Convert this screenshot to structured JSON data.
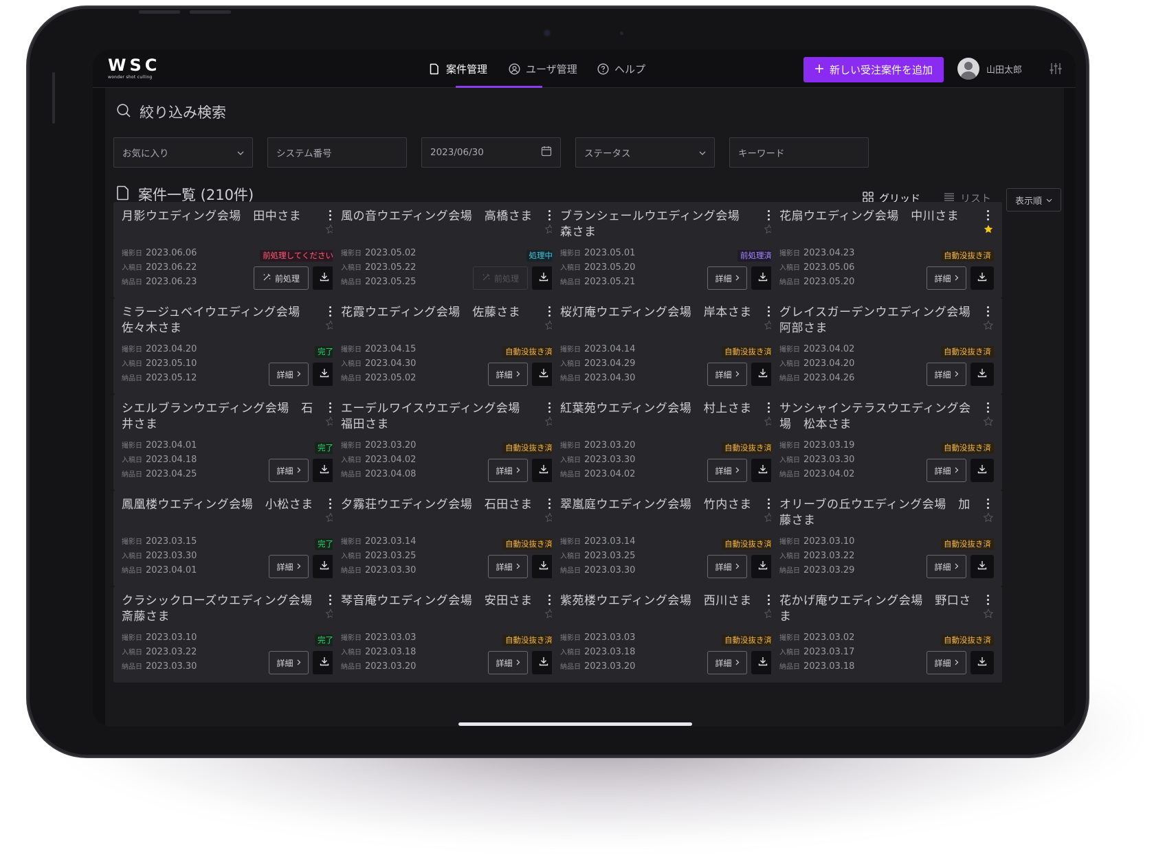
{
  "app": {
    "logo": "WSC",
    "logo_sub": "wonder shot culling"
  },
  "nav": {
    "items": [
      {
        "label": "案件管理",
        "icon": "document-icon",
        "active": true
      },
      {
        "label": "ユーザ管理",
        "icon": "user-icon",
        "active": false
      },
      {
        "label": "ヘルプ",
        "icon": "help-icon",
        "active": false
      }
    ],
    "add_button": "新しい受注案件を追加",
    "user_name": "山田太郎"
  },
  "search": {
    "title": "絞り込み検索",
    "favorites": "お気に入り",
    "system_number": "システム番号",
    "date": "2023/06/30",
    "status": "ステータス",
    "keyword": "キーワード"
  },
  "list": {
    "title": "案件一覧 (210件)",
    "grid_label": "グリッド",
    "list_label": "リスト",
    "sort_label": "表示順"
  },
  "labels": {
    "shoot": "撮影日",
    "entry": "入稿日",
    "delivery": "納品日",
    "detail": "詳細",
    "preprocess": "前処理"
  },
  "colors": {
    "accent": "#8a2bf2",
    "warn": "#ff5a7a",
    "processing": "#3fc7e0",
    "preprocessed": "#a58cff",
    "done": "#2ed47a",
    "auto": "#f2b84b",
    "favorite_star": "#f5c518"
  },
  "cards": [
    {
      "title": "月影ウエディング会場　田中さま",
      "shoot": "2023.06.06",
      "entry": "2023.06.22",
      "delivery": "2023.06.23",
      "status": "前処理してください",
      "status_type": "warn",
      "action": "preprocess",
      "favorite": false
    },
    {
      "title": "風の音ウエディング会場　高橋さま",
      "shoot": "2023.05.02",
      "entry": "2023.05.22",
      "delivery": "2023.05.25",
      "status": "処理中",
      "status_type": "proc",
      "action": "preprocess-disabled",
      "favorite": false
    },
    {
      "title": "ブランシェールウエディング会場　森さま",
      "shoot": "2023.05.01",
      "entry": "2023.05.20",
      "delivery": "2023.05.21",
      "status": "前処理済",
      "status_type": "pre",
      "action": "detail",
      "favorite": false
    },
    {
      "title": "花扇ウエディング会場　中川さま",
      "shoot": "2023.04.23",
      "entry": "2023.05.06",
      "delivery": "2023.05.20",
      "status": "自動没抜き済",
      "status_type": "auto",
      "action": "detail",
      "favorite": true
    },
    {
      "title": "ミラージュベイウエディング会場　佐々木さま",
      "shoot": "2023.04.20",
      "entry": "2023.05.10",
      "delivery": "2023.05.12",
      "status": "完了",
      "status_type": "done",
      "action": "detail",
      "favorite": false
    },
    {
      "title": "花霞ウエディング会場　佐藤さま",
      "shoot": "2023.04.15",
      "entry": "2023.04.30",
      "delivery": "2023.05.02",
      "status": "自動没抜き済",
      "status_type": "auto",
      "action": "detail",
      "favorite": false
    },
    {
      "title": "桜灯庵ウエディング会場　岸本さま",
      "shoot": "2023.04.14",
      "entry": "2023.04.29",
      "delivery": "2023.04.30",
      "status": "自動没抜き済",
      "status_type": "auto",
      "action": "detail",
      "favorite": false
    },
    {
      "title": "グレイスガーデンウエディング会場　阿部さま",
      "shoot": "2023.04.02",
      "entry": "2023.04.20",
      "delivery": "2023.04.26",
      "status": "自動没抜き済",
      "status_type": "auto",
      "action": "detail",
      "favorite": false
    },
    {
      "title": "シエルブランウエディング会場　石井さま",
      "shoot": "2023.04.01",
      "entry": "2023.04.18",
      "delivery": "2023.04.25",
      "status": "完了",
      "status_type": "done",
      "action": "detail",
      "favorite": false
    },
    {
      "title": "エーデルワイスウエディング会場　福田さま",
      "shoot": "2023.03.20",
      "entry": "2023.04.02",
      "delivery": "2023.04.08",
      "status": "自動没抜き済",
      "status_type": "auto",
      "action": "detail",
      "favorite": false
    },
    {
      "title": "紅葉苑ウエディング会場　村上さま",
      "shoot": "2023.03.20",
      "entry": "2023.03.30",
      "delivery": "2023.04.02",
      "status": "自動没抜き済",
      "status_type": "auto",
      "action": "detail",
      "favorite": false
    },
    {
      "title": "サンシャインテラスウエディング会場　松本さま",
      "shoot": "2023.03.19",
      "entry": "2023.03.30",
      "delivery": "2023.04.02",
      "status": "自動没抜き済",
      "status_type": "auto",
      "action": "detail",
      "favorite": false
    },
    {
      "title": "鳳凰楼ウエディング会場　小松さま",
      "shoot": "2023.03.15",
      "entry": "2023.03.30",
      "delivery": "2023.04.01",
      "status": "完了",
      "status_type": "done",
      "action": "detail",
      "favorite": false
    },
    {
      "title": "夕霧荘ウエディング会場　石田さま",
      "shoot": "2023.03.14",
      "entry": "2023.03.25",
      "delivery": "2023.03.30",
      "status": "自動没抜き済",
      "status_type": "auto",
      "action": "detail",
      "favorite": false
    },
    {
      "title": "翠嵐庭ウエディング会場　竹内さま",
      "shoot": "2023.03.14",
      "entry": "2023.03.25",
      "delivery": "2023.03.30",
      "status": "自動没抜き済",
      "status_type": "auto",
      "action": "detail",
      "favorite": false
    },
    {
      "title": "オリーブの丘ウエディング会場　加藤さま",
      "shoot": "2023.03.10",
      "entry": "2023.03.22",
      "delivery": "2023.03.29",
      "status": "自動没抜き済",
      "status_type": "auto",
      "action": "detail",
      "favorite": false
    },
    {
      "title": "クラシックローズウエディング会場　斎藤さま",
      "shoot": "2023.03.10",
      "entry": "2023.03.22",
      "delivery": "2023.03.30",
      "status": "完了",
      "status_type": "done",
      "action": "detail",
      "favorite": false
    },
    {
      "title": "琴音庵ウエディング会場　安田さま",
      "shoot": "2023.03.03",
      "entry": "2023.03.18",
      "delivery": "2023.03.20",
      "status": "自動没抜き済",
      "status_type": "auto",
      "action": "detail",
      "favorite": false
    },
    {
      "title": "紫苑楼ウエディング会場　西川さま",
      "shoot": "2023.03.03",
      "entry": "2023.03.18",
      "delivery": "2023.03.20",
      "status": "自動没抜き済",
      "status_type": "auto",
      "action": "detail",
      "favorite": false
    },
    {
      "title": "花かげ庵ウエディング会場　野口さま",
      "shoot": "2023.03.02",
      "entry": "2023.03.17",
      "delivery": "2023.03.18",
      "status": "自動没抜き済",
      "status_type": "auto",
      "action": "detail",
      "favorite": false
    }
  ]
}
